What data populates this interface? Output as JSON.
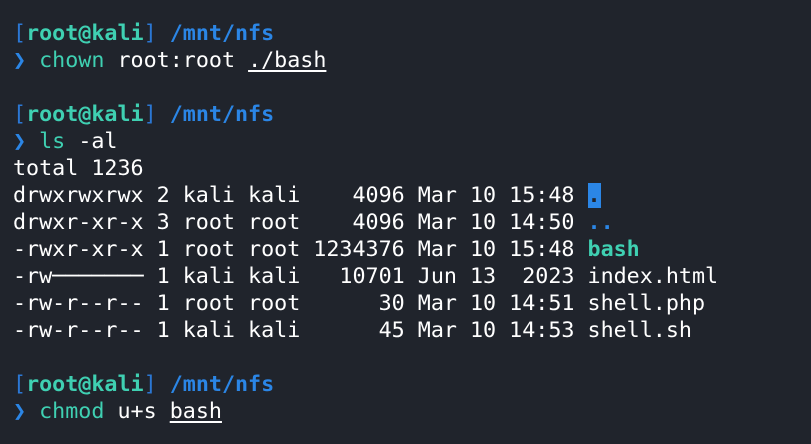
{
  "prompt": {
    "open_bracket": "[",
    "user": "root",
    "at": "@",
    "host": "kali",
    "close_bracket": "]",
    "cwd": "/mnt/nfs",
    "arrow": "❯"
  },
  "commands": [
    {
      "cmd": "chown",
      "args_plain": "root:root ",
      "args_underlined": "./bash"
    },
    {
      "cmd": "ls",
      "args_plain": "-al",
      "args_underlined": ""
    },
    {
      "cmd": "chmod",
      "args_plain": "u+s ",
      "args_underlined": "bash"
    }
  ],
  "ls_output": {
    "total": "total 1236",
    "rows": [
      {
        "meta": "drwxrwxrwx 2 kali kali    4096 Mar 10 15:48 ",
        "name": ".",
        "kind": "dir-highlight"
      },
      {
        "meta": "drwxr-xr-x 3 root root    4096 Mar 10 14:50 ",
        "name": "..",
        "kind": "dir"
      },
      {
        "meta": "-rwxr-xr-x 1 root root 1234376 Mar 10 15:48 ",
        "name": "bash",
        "kind": "exe"
      },
      {
        "meta": "-rw─────── 1 kali kali   10701 Jun 13  2023 ",
        "name": "index.html",
        "kind": "file"
      },
      {
        "meta": "-rw-r--r-- 1 root root      30 Mar 10 14:51 ",
        "name": "shell.php",
        "kind": "file"
      },
      {
        "meta": "-rw-r--r-- 1 kali kali      45 Mar 10 14:53 ",
        "name": "shell.sh",
        "kind": "file"
      }
    ]
  },
  "colors": {
    "background": "#20242c",
    "prompt_blue": "#2b86e6",
    "accent_teal": "#3fd0b2",
    "text": "#ffffff"
  }
}
